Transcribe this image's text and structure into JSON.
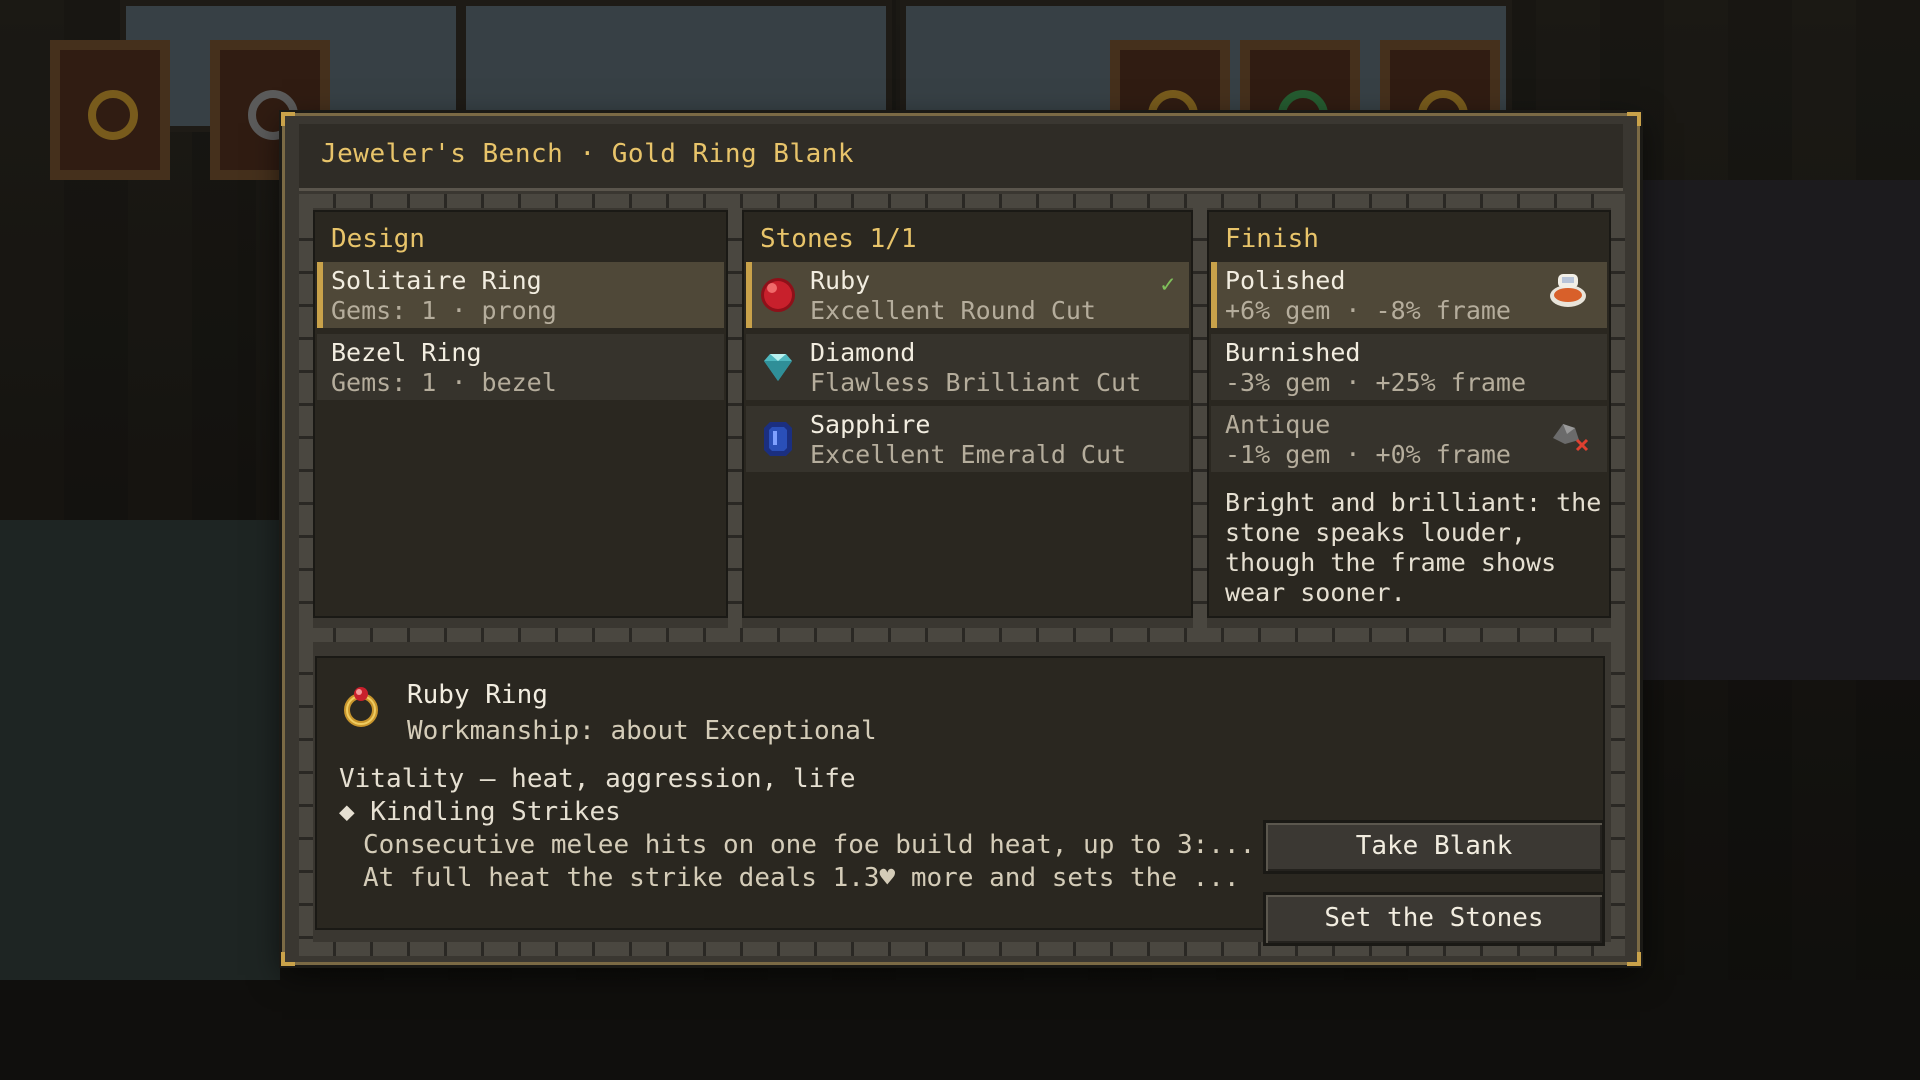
{
  "title": "Jeweler's Bench · Gold Ring Blank",
  "design": {
    "header": "Design",
    "items": [
      {
        "name": "Solitaire Ring",
        "detail": "Gems: 1 · prong",
        "selected": true
      },
      {
        "name": "Bezel Ring",
        "detail": "Gems: 1 · bezel",
        "selected": false
      }
    ]
  },
  "stones": {
    "header": "Stones 1/1",
    "items": [
      {
        "name": "Ruby",
        "detail": "Excellent Round Cut",
        "icon": "ruby-icon",
        "selected": true,
        "check": "✓"
      },
      {
        "name": "Diamond",
        "detail": "Flawless Brilliant Cut",
        "icon": "diamond-icon",
        "selected": false
      },
      {
        "name": "Sapphire",
        "detail": "Excellent Emerald Cut",
        "icon": "sapphire-icon",
        "selected": false
      }
    ]
  },
  "finish": {
    "header": "Finish",
    "items": [
      {
        "name": "Polished",
        "detail": "+6% gem · -8% frame",
        "icon": "polish-cloth-icon",
        "selected": true
      },
      {
        "name": "Burnished",
        "detail": "-3% gem · +25% frame",
        "selected": false
      },
      {
        "name": "Antique",
        "detail": "-1% gem · +0% frame",
        "icon": "missing-material-icon",
        "selected": false,
        "disabled": true
      }
    ],
    "description": "Bright and brilliant: the stone speaks louder, though the frame shows wear sooner."
  },
  "result": {
    "name": "Ruby Ring",
    "workmanship": "Workmanship: about Exceptional",
    "trait": "Vitality — heat, aggression, life",
    "ability": "◆ Kindling Strikes",
    "ability_lines": [
      "Consecutive melee hits on one foe build heat, up to 3:...",
      "At full heat the strike deals 1.3♥ more and sets the ..."
    ]
  },
  "buttons": {
    "take_blank": "Take Blank",
    "set_stones": "Set the Stones"
  },
  "colors": {
    "accent_gold": "#c9a24a",
    "title_gold": "#e8c46a",
    "check_green": "#7fbf5a",
    "ruby": "#c8202c",
    "diamond": "#6fd6d8",
    "sapphire": "#2a4fb8"
  }
}
